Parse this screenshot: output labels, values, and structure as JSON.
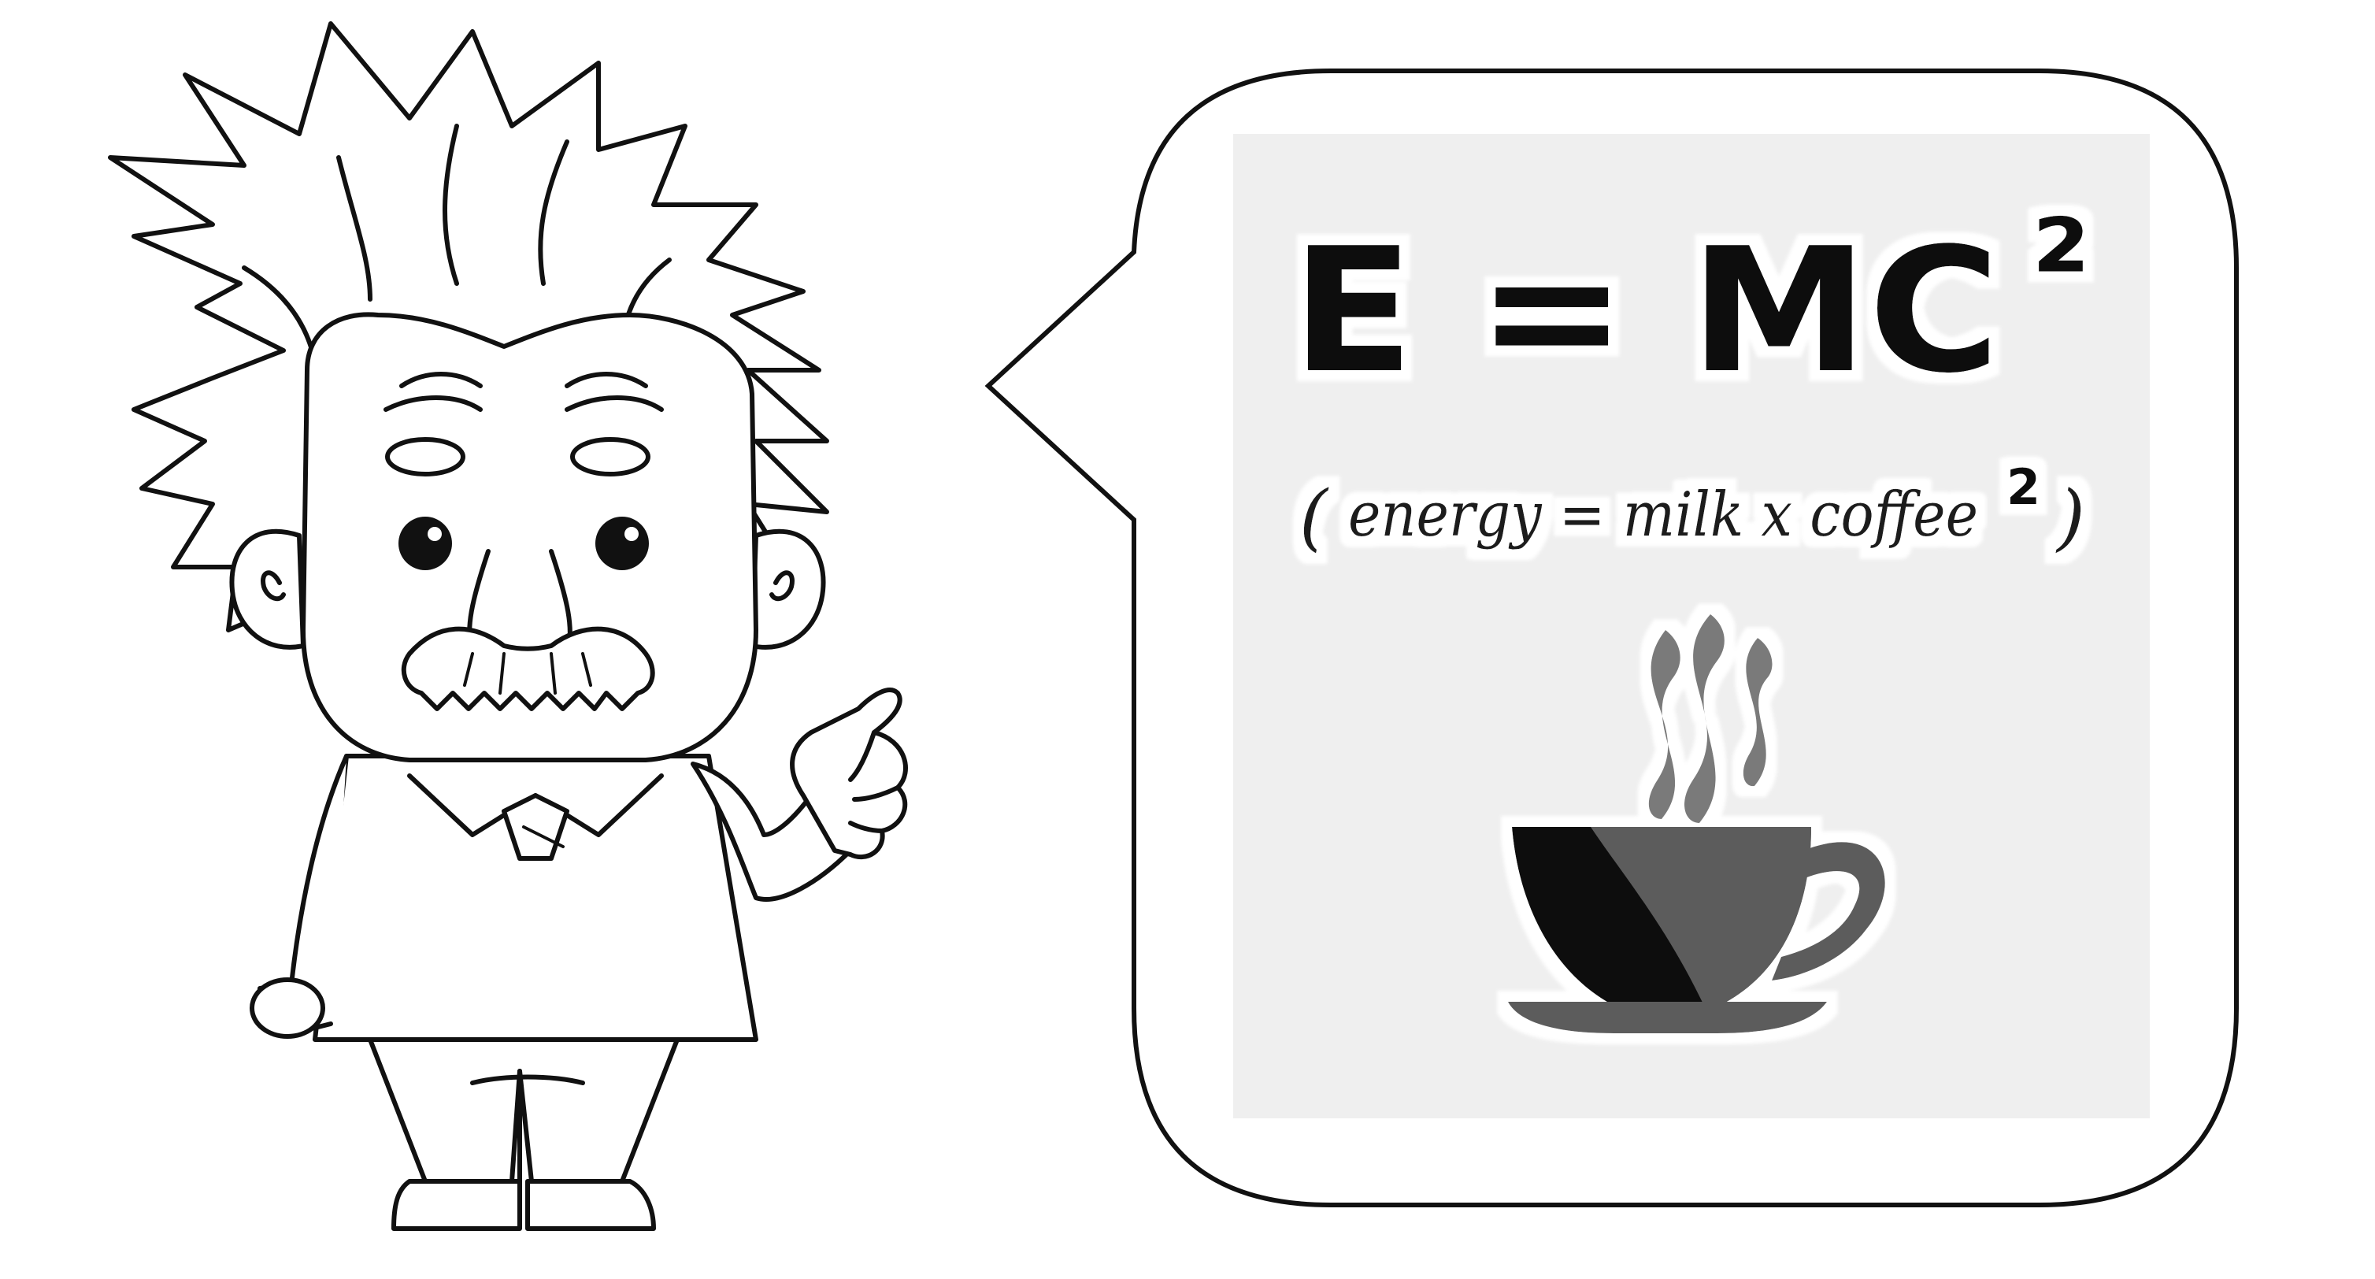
{
  "formula": {
    "main": "E = MC",
    "superscript": "²"
  },
  "subtitle": {
    "open": "(",
    "text": "energy = milk x coffee",
    "superscript": "2",
    "close": ")"
  },
  "icons": {
    "character": "cartoon-scientist-icon",
    "cup": "coffee-cup-icon",
    "steam": "steam-icon"
  },
  "colors": {
    "background": "#ffffff",
    "line": "#111111",
    "panel": "#efefef",
    "sticker_outline": "#ffffff",
    "cup": "#0d0d0d",
    "cup_shade": "#5c5c5c",
    "steam": "#7a7a7a"
  }
}
